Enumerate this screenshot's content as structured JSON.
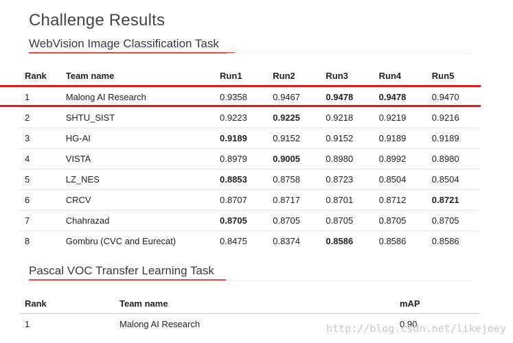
{
  "page_title": "Challenge Results",
  "webvision": {
    "title": "WebVision Image Classification Task",
    "columns": [
      "Rank",
      "Team name",
      "Run1",
      "Run2",
      "Run3",
      "Run4",
      "Run5"
    ],
    "rows": [
      {
        "rank": "1",
        "team": "Malong AI Research",
        "runs": [
          "0.9358",
          "0.9467",
          "0.9478",
          "0.9478",
          "0.9470"
        ],
        "bold": [
          false,
          false,
          true,
          true,
          false
        ],
        "highlighted": true
      },
      {
        "rank": "2",
        "team": "SHTU_SIST",
        "runs": [
          "0.9223",
          "0.9225",
          "0.9218",
          "0.9219",
          "0.9216"
        ],
        "bold": [
          false,
          true,
          false,
          false,
          false
        ]
      },
      {
        "rank": "3",
        "team": "HG-AI",
        "runs": [
          "0.9189",
          "0.9152",
          "0.9152",
          "0.9189",
          "0.9189"
        ],
        "bold": [
          true,
          false,
          false,
          false,
          false
        ]
      },
      {
        "rank": "4",
        "team": "VISTA",
        "runs": [
          "0.8979",
          "0.9005",
          "0.8980",
          "0.8992",
          "0.8980"
        ],
        "bold": [
          false,
          true,
          false,
          false,
          false
        ]
      },
      {
        "rank": "5",
        "team": "LZ_NES",
        "runs": [
          "0.8853",
          "0.8758",
          "0.8723",
          "0.8504",
          "0.8504"
        ],
        "bold": [
          true,
          false,
          false,
          false,
          false
        ]
      },
      {
        "rank": "6",
        "team": "CRCV",
        "runs": [
          "0.8707",
          "0.8717",
          "0.8701",
          "0.8712",
          "0.8721"
        ],
        "bold": [
          false,
          false,
          false,
          false,
          true
        ]
      },
      {
        "rank": "7",
        "team": "Chahrazad",
        "runs": [
          "0.8705",
          "0.8705",
          "0.8705",
          "0.8705",
          "0.8705"
        ],
        "bold": [
          true,
          false,
          false,
          false,
          false
        ]
      },
      {
        "rank": "8",
        "team": "Gombru (CVC and Eurecat)",
        "runs": [
          "0.8475",
          "0.8374",
          "0.8586",
          "0.8586",
          "0.8586"
        ],
        "bold": [
          false,
          false,
          true,
          false,
          false
        ]
      }
    ]
  },
  "pascal": {
    "title": "Pascal VOC Transfer Learning Task",
    "columns": [
      "Rank",
      "Team name",
      "mAP"
    ],
    "rows": [
      {
        "rank": "1",
        "team": "Malong AI Research",
        "map": "0.90"
      }
    ]
  },
  "watermark": "http://blog.csdn.net/likejoey",
  "colors": {
    "accent_underline": "#e8453c",
    "highlight_line": "#e21a1a"
  }
}
